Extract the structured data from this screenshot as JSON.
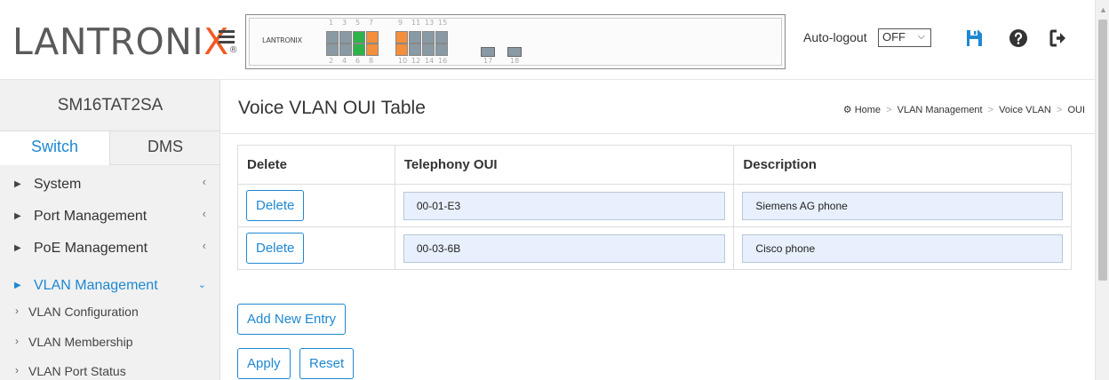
{
  "header": {
    "logo_text": "LANTRONIX",
    "logo_registered": "®",
    "device_logo": "LANTRONIX",
    "ports_top": [
      "1",
      "3",
      "5",
      "7",
      "9",
      "11",
      "13",
      "15"
    ],
    "ports_bottom": [
      "2",
      "4",
      "6",
      "8",
      "10",
      "12",
      "14",
      "16",
      "17",
      "18"
    ],
    "port_colors": {
      "gray": "#8a9aa5",
      "green": "#2db34a",
      "orange": "#f58f3c"
    },
    "autologout_label": "Auto-logout",
    "autologout_value": "OFF",
    "icons": [
      "save-icon",
      "help-icon",
      "logout-icon"
    ],
    "accent_color": "#1e88d2"
  },
  "sidebar": {
    "model": "SM16TAT2SA",
    "tabs": [
      {
        "label": "Switch",
        "active": true
      },
      {
        "label": "DMS",
        "active": false
      }
    ],
    "items": [
      {
        "label": "System"
      },
      {
        "label": "Port Management"
      },
      {
        "label": "PoE Management"
      },
      {
        "label": "VLAN Management",
        "active": true
      }
    ],
    "subitems": [
      {
        "label": "VLAN Configuration"
      },
      {
        "label": "VLAN Membership"
      },
      {
        "label": "VLAN Port Status"
      }
    ]
  },
  "main": {
    "title": "Voice VLAN OUI Table",
    "breadcrumb": [
      "Home",
      "VLAN Management",
      "Voice VLAN",
      "OUI"
    ],
    "table": {
      "headers": [
        "Delete",
        "Telephony OUI",
        "Description"
      ],
      "rows": [
        {
          "delete_label": "Delete",
          "oui": "00-01-E3",
          "description": "Siemens AG phone"
        },
        {
          "delete_label": "Delete",
          "oui": "00-03-6B",
          "description": "Cisco phone"
        }
      ]
    },
    "add_button": "Add New Entry",
    "apply_button": "Apply",
    "reset_button": "Reset"
  }
}
